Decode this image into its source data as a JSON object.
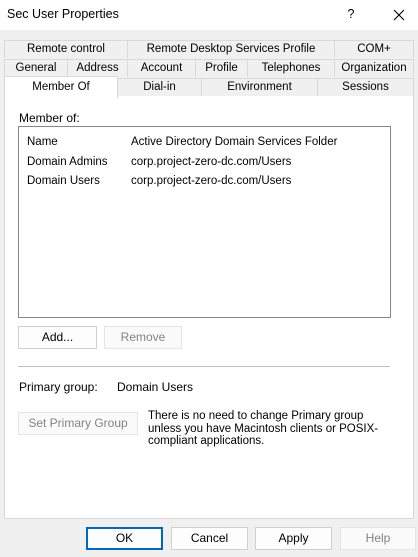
{
  "window": {
    "title": "Sec User Properties",
    "help_label": "?"
  },
  "tabs": {
    "row1": [
      {
        "label": "Remote control"
      },
      {
        "label": "Remote Desktop Services Profile"
      },
      {
        "label": "COM+"
      }
    ],
    "row2": [
      {
        "label": "General"
      },
      {
        "label": "Address"
      },
      {
        "label": "Account"
      },
      {
        "label": "Profile"
      },
      {
        "label": "Telephones"
      },
      {
        "label": "Organization"
      }
    ],
    "row3": [
      {
        "label": "Member Of",
        "selected": true
      },
      {
        "label": "Dial-in"
      },
      {
        "label": "Environment"
      },
      {
        "label": "Sessions"
      }
    ]
  },
  "member_of": {
    "label": "Member of:",
    "columns": [
      "Name",
      "Active Directory Domain Services Folder"
    ],
    "rows": [
      {
        "name": "Domain Admins",
        "folder": "corp.project-zero-dc.com/Users"
      },
      {
        "name": "Domain Users",
        "folder": "corp.project-zero-dc.com/Users"
      }
    ],
    "add_label": "Add...",
    "remove_label": "Remove"
  },
  "primary_group": {
    "label": "Primary group:",
    "value": "Domain Users",
    "set_button_label": "Set Primary Group",
    "info_text": "There is no need to change Primary group unless you have Macintosh clients or POSIX-compliant applications."
  },
  "footer": {
    "ok_label": "OK",
    "cancel_label": "Cancel",
    "apply_label": "Apply",
    "help_label": "Help"
  }
}
